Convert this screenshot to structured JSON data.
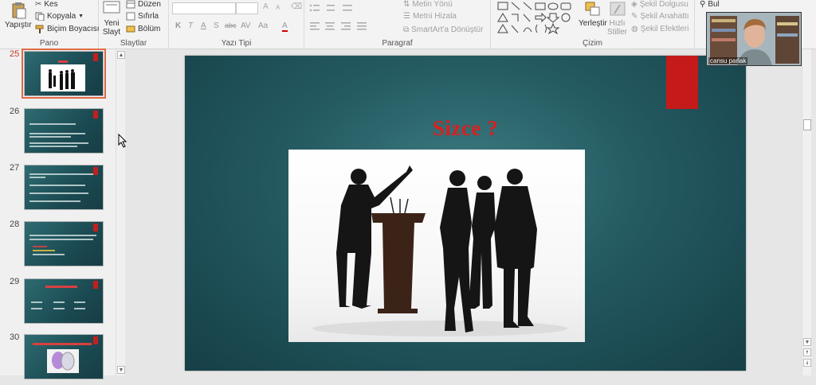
{
  "ribbon": {
    "clipboard": {
      "paste_label": "Yapıştır",
      "cut_label": "Kes",
      "copy_label": "Kopyala",
      "format_painter_label": "Biçim Boyacısı",
      "group_label": "Pano"
    },
    "slides": {
      "new_slide_label_1": "Yeni",
      "new_slide_label_2": "Slayt",
      "layout_label": "Düzen",
      "reset_label": "Sıfırla",
      "section_label": "Bölüm",
      "group_label": "Slaytlar"
    },
    "font": {
      "font_name_value": "",
      "font_size_value": "",
      "bold": "K",
      "italic": "T",
      "underline": "A",
      "shadow": "S",
      "strikethrough": "abc",
      "spacing": "AV",
      "case": "Aa",
      "grow": "A",
      "shrink": "A",
      "color": "A",
      "group_label": "Yazı Tipi"
    },
    "paragraph": {
      "text_direction_label": "Metin Yönü",
      "align_text_label": "Metni Hizala",
      "smartart_label": "SmartArt'a Dönüştür",
      "group_label": "Paragraf"
    },
    "drawing": {
      "arrange_label": "Yerleştir",
      "quick_styles_label_1": "Hızlı",
      "quick_styles_label_2": "Stiller",
      "shape_fill_label": "Şekil Dolgusu",
      "shape_outline_label": "Şekil Anahattı",
      "shape_effects_label": "Şekil Efektleri",
      "group_label": "Çizim"
    },
    "editing": {
      "find_label": "Bul"
    }
  },
  "thumbnails": [
    {
      "num": "25",
      "active": true
    },
    {
      "num": "26",
      "active": false
    },
    {
      "num": "27",
      "active": false
    },
    {
      "num": "28",
      "active": false
    },
    {
      "num": "29",
      "active": false
    },
    {
      "num": "30",
      "active": false
    }
  ],
  "slide": {
    "title": "Sizce ?"
  },
  "webcam": {
    "name": "cansu parlak"
  },
  "colors": {
    "accent_red": "#c41a1a",
    "slide_bg": "#245a61",
    "selection": "#e06a44"
  }
}
